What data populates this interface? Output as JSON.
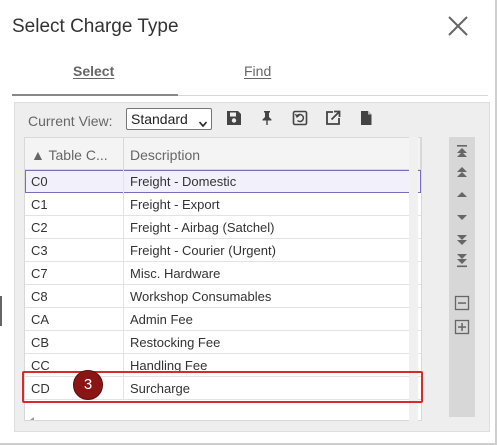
{
  "dialog": {
    "title": "Select Charge Type"
  },
  "tabs": [
    {
      "label": "Select",
      "active": true
    },
    {
      "label": "Find",
      "active": false
    }
  ],
  "toolbar": {
    "current_view_label": "Current View:",
    "view_value": "Standard",
    "icons": [
      "save-icon",
      "pin-icon",
      "restore-icon",
      "export-icon",
      "document-icon"
    ]
  },
  "grid": {
    "columns": [
      "▲ Table C...",
      "Description"
    ],
    "rows": [
      {
        "code": "C0",
        "description": "Freight - Domestic",
        "selected": true
      },
      {
        "code": "C1",
        "description": "Freight - Export"
      },
      {
        "code": "C2",
        "description": "Freight - Airbag (Satchel)"
      },
      {
        "code": "C3",
        "description": "Freight - Courier (Urgent)"
      },
      {
        "code": "C7",
        "description": "Misc. Hardware"
      },
      {
        "code": "C8",
        "description": "Workshop Consumables"
      },
      {
        "code": "CA",
        "description": "Admin Fee"
      },
      {
        "code": "CB",
        "description": "Restocking Fee"
      },
      {
        "code": "CC",
        "description": "Handling Fee"
      },
      {
        "code": "CD",
        "description": "Surcharge",
        "highlighted": true
      }
    ]
  },
  "annotation": {
    "step_number": "3"
  },
  "colors": {
    "selected_row_border": "#7b6bb8",
    "highlight_border": "#d62b2b",
    "badge_fill": "#8b1515"
  }
}
